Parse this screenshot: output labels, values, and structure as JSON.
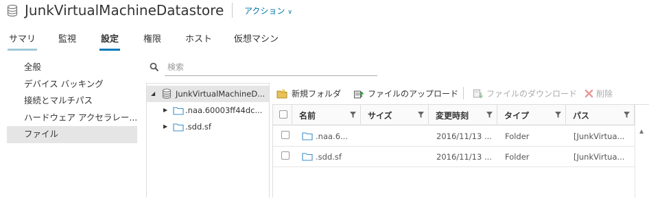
{
  "header": {
    "title": "JunkVirtualMachineDatastore",
    "actions_label": "アクション",
    "datastore_icon": "datastore-icon"
  },
  "tabs": [
    {
      "label": "サマリ"
    },
    {
      "label": "監視"
    },
    {
      "label": "設定",
      "active": true
    },
    {
      "label": "権限"
    },
    {
      "label": "ホスト"
    },
    {
      "label": "仮想マシン"
    }
  ],
  "leftnav": {
    "items": [
      {
        "label": "全般"
      },
      {
        "label": "デバイス バッキング"
      },
      {
        "label": "接続とマルチパス"
      },
      {
        "label": "ハードウェア アクセラレー..."
      },
      {
        "label": "ファイル",
        "active": true
      }
    ]
  },
  "search": {
    "placeholder": "検索"
  },
  "tree": {
    "root": "JunkVirtualMachineD...",
    "children": [
      {
        "label": ".naa.60003ff44dc..."
      },
      {
        "label": ".sdd.sf"
      }
    ]
  },
  "toolbar": {
    "new_folder": "新規フォルダ",
    "upload": "ファイルのアップロード",
    "download": "ファイルのダウンロード",
    "delete": "削除"
  },
  "table": {
    "columns": [
      "名前",
      "サイズ",
      "変更時刻",
      "タイプ",
      "パス"
    ],
    "rows": [
      {
        "name": ".naa.6...",
        "size": "",
        "modified": "2016/11/13 ...",
        "type": "Folder",
        "path": "[JunkVirtua..."
      },
      {
        "name": ".sdd.sf",
        "size": "",
        "modified": "2016/11/13 ...",
        "type": "Folder",
        "path": "[JunkVirtua..."
      }
    ]
  },
  "colors": {
    "accent": "#0079b8",
    "link": "#0072a3",
    "folder_outline": "#3b8ec7",
    "delete_disabled": "#e89a9a"
  }
}
